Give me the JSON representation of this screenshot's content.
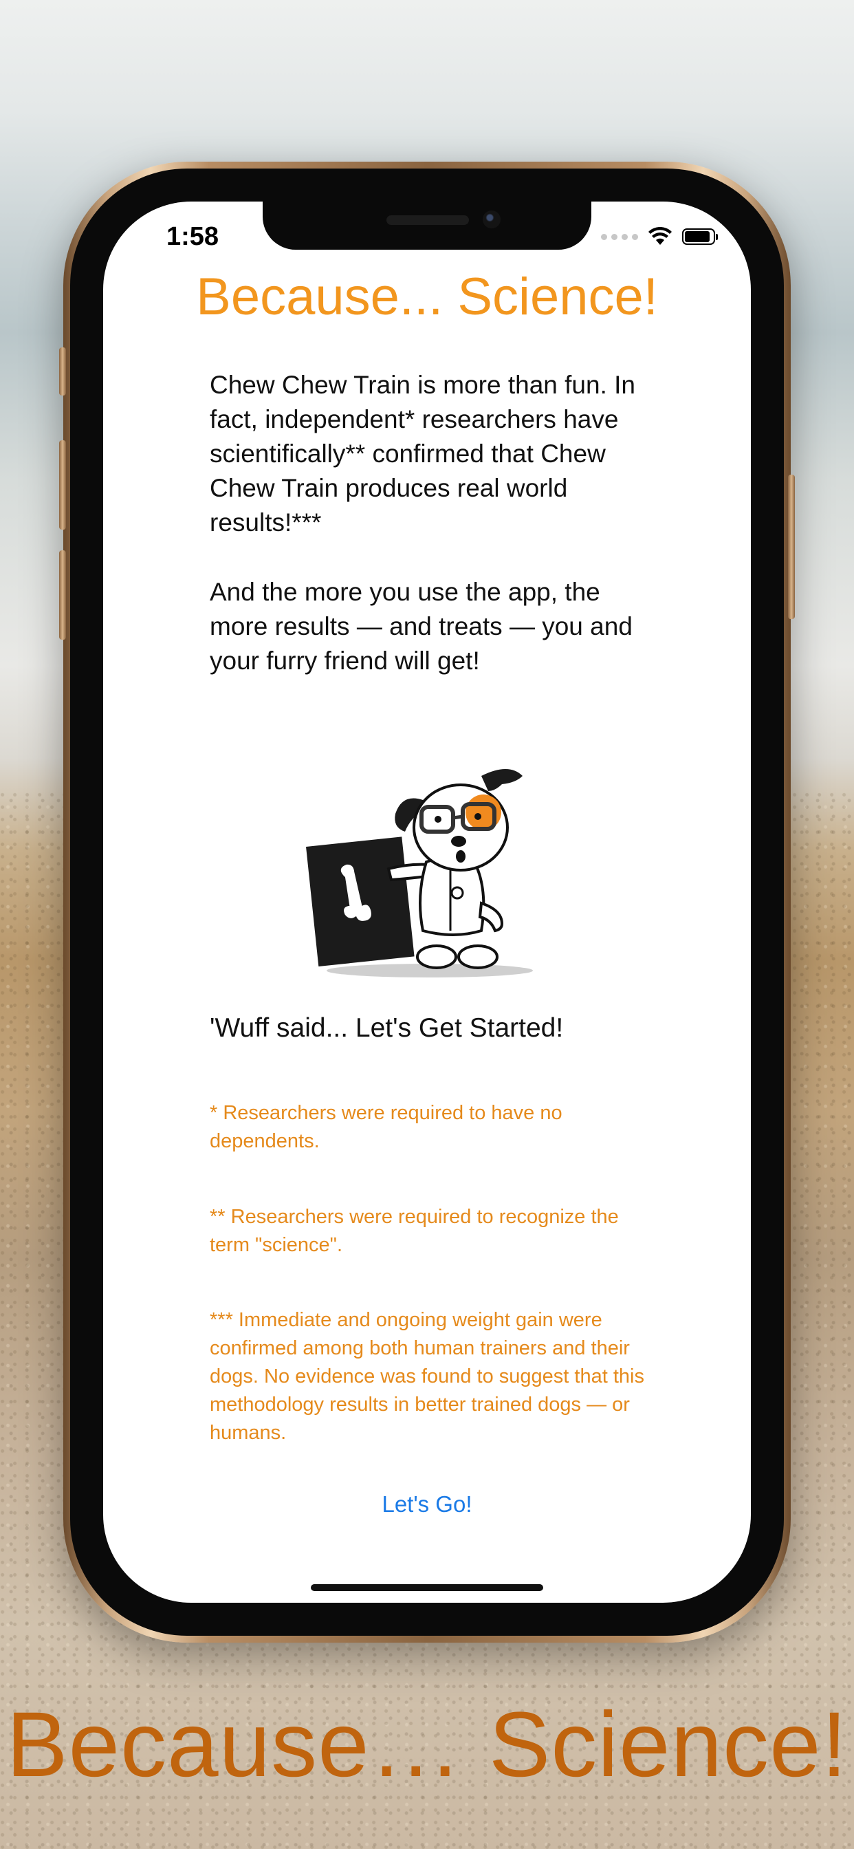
{
  "status_bar": {
    "time": "1:58"
  },
  "screen": {
    "title": "Because... Science!",
    "paragraph_1": "Chew Chew Train is more than fun. In fact, independent* researchers have scientifically** confirmed that Chew Chew Train produces real world results!***",
    "paragraph_2": "And the more you use the app, the more results — and treats — you and your furry friend will get!",
    "illustration": "scientist-dog-illustration",
    "tagline": "'Wuff said... Let's Get Started!",
    "footnotes": [
      "* Researchers were required to have no dependents.",
      "** Researchers were required to recognize the term \"science\".",
      "*** Immediate and ongoing weight gain were confirmed among both human trainers and their dogs. No evidence was found to suggest that this methodology results in better trained dogs — or humans."
    ],
    "go_button": "Let's Go!"
  },
  "caption": "Because… Science!",
  "colors": {
    "accent": "#f2961e",
    "link": "#1a7ae6",
    "caption": "#c0640e"
  }
}
